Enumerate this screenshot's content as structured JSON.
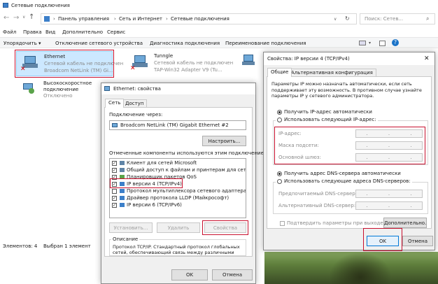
{
  "explorer": {
    "title": "Сетевые подключения",
    "address": [
      "Панель управления",
      "Сеть и Интернет",
      "Сетевые подключения"
    ],
    "search_placeholder": "Поиск: Сетев...",
    "menu": [
      "Файл",
      "Правка",
      "Вид",
      "Дополнительно",
      "Сервис"
    ],
    "toolbar": [
      "Упорядочить ▾",
      "Отключение сетевого устройства",
      "Диагностика подключения",
      "Переименование подключения"
    ],
    "status_items": "Элементов: 4",
    "status_selected": "Выбран 1 элемент",
    "items": [
      {
        "name": "Ethernet",
        "line2": "Сетевой кабель не подключен",
        "line3": "Broadcom NetLink (TM) Gi..."
      },
      {
        "name": "Tunngle",
        "line2": "Сетевой кабель не подключен",
        "line3": "TAP-Win32 Adapter V9 (Tu..."
      },
      {
        "name": "Высокоскоростное подключение",
        "line2": "Отключено",
        "line3": ""
      }
    ]
  },
  "ethprops": {
    "title": "Ethernet: свойства",
    "tabs": [
      "Сеть",
      "Доступ"
    ],
    "connect_via_label": "Подключение через:",
    "adapter": "Broadcom NetLink (TM) Gigabit Ethernet #2",
    "configure": "Настроить...",
    "components_label": "Отмеченные компоненты используются этим подключением:",
    "components": [
      {
        "label": "Клиент для сетей Microsoft",
        "checked": true
      },
      {
        "label": "Общий доступ к файлам и принтерам для сетей Mi",
        "checked": true
      },
      {
        "label": "Планировщик пакетов QoS",
        "checked": true
      },
      {
        "label": "IP версии 4 (TCP/IPv4)",
        "checked": true
      },
      {
        "label": "Протокол мультиплексора сетевого адаптера (Ма",
        "checked": false
      },
      {
        "label": "Драйвер протокола LLDP (Майкрософт)",
        "checked": true
      },
      {
        "label": "IP версии 6 (TCP/IPv6)",
        "checked": true
      }
    ],
    "install": "Установить...",
    "remove": "Удалить",
    "properties": "Свойства",
    "description_label": "Описание",
    "description": "Протокол TCP/IP. Стандартный протокол глобальных сетей, обеспечивающий связь между различными взаимодействующими сетями.",
    "ok": "OK",
    "cancel": "Отмена"
  },
  "ipv4": {
    "title": "Свойства: IP версии 4 (TCP/IPv4)",
    "tabs": [
      "Общие",
      "Альтернативная конфигурация"
    ],
    "intro": "Параметры IP можно назначать автоматически, если сеть поддерживает эту возможность. В противном случае узнайте параметры IP у сетевого администратора.",
    "auto_ip": "Получить IP-адрес автоматически",
    "manual_ip": "Использовать следующий IP-адрес:",
    "ip_label": "IP-адрес:",
    "mask_label": "Маска подсети:",
    "gateway_label": "Основной шлюз:",
    "auto_dns": "Получить адрес DNS-сервера автоматически",
    "manual_dns": "Использовать следующие адреса DNS-серверов:",
    "pref_dns": "Предпочитаемый DNS-сервер:",
    "alt_dns": "Альтернативный DNS-сервер:",
    "validate": "Подтвердить параметры при выходе",
    "advanced": "Дополнительно...",
    "ok": "OK",
    "cancel": "Отмена",
    "close": "✕"
  },
  "colors": {
    "accent": "#0078d7",
    "highlight": "#c8102e",
    "selection": "#cce8ff"
  }
}
